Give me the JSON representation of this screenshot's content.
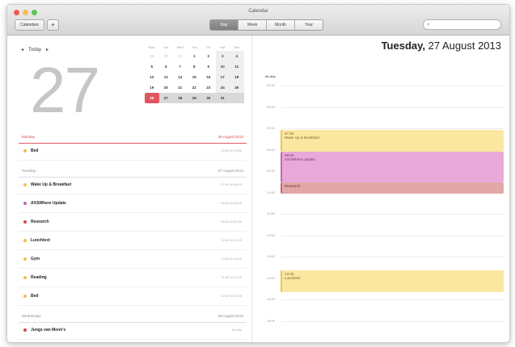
{
  "window": {
    "title": "Calendar",
    "calendars_label": "Calendars",
    "add_label": "+"
  },
  "view_tabs": [
    "Day",
    "Week",
    "Month",
    "Year"
  ],
  "active_tab": "Day",
  "left": {
    "nav": {
      "prev": "◂",
      "today": "Today",
      "next": "▸"
    },
    "big_day": "27",
    "mini_cal": {
      "weekdays": [
        "Mon",
        "Tue",
        "Wed",
        "Thu",
        "Fri",
        "Sat",
        "Sun"
      ],
      "rows": [
        [
          "29",
          "30",
          "31",
          "1",
          "2",
          "3",
          "4"
        ],
        [
          "5",
          "6",
          "7",
          "8",
          "9",
          "10",
          "11"
        ],
        [
          "12",
          "13",
          "14",
          "15",
          "16",
          "17",
          "18"
        ],
        [
          "19",
          "20",
          "21",
          "22",
          "23",
          "24",
          "25"
        ],
        [
          "26",
          "27",
          "28",
          "29",
          "30",
          "31",
          ""
        ]
      ],
      "selected": "26"
    },
    "sections": [
      {
        "label": "Monday",
        "date": "26 August 2013",
        "color": "red",
        "events": [
          {
            "title": "Bed",
            "time": "22:30 to 23:00",
            "dot": "#f4bd4f"
          }
        ]
      },
      {
        "label": "Tuesday",
        "date": "27 August 2013",
        "color": "grey",
        "events": [
          {
            "title": "Wake Up & Breakfast",
            "time": "07:00 to 08:00",
            "dot": "#f4bd4f"
          },
          {
            "title": "AXSWhere Update",
            "time": "08:00 to 09:00",
            "dot": "#c466ae"
          },
          {
            "title": "Research",
            "time": "09:00 to 09:30",
            "dot": "#d24951"
          },
          {
            "title": "Lunchtext",
            "time": "12:00 to 13:00",
            "dot": "#f4bd4f"
          },
          {
            "title": "Gym",
            "time": "13:30 to 15:00",
            "dot": "#f4bd4f"
          },
          {
            "title": "Reading",
            "time": "21:00 to 22:00",
            "dot": "#f4bd4f"
          },
          {
            "title": "Bed",
            "time": "22:30 to 23:00",
            "dot": "#f4bd4f"
          }
        ]
      },
      {
        "label": "Wednesday",
        "date": "28 August 2013",
        "color": "grey",
        "events": [
          {
            "title": "Jungs van Menn's",
            "time": "All-day",
            "dot": "#d24951"
          }
        ]
      }
    ]
  },
  "right": {
    "date_weekday": "Tuesday,",
    "date_rest": "27 August 2013",
    "allday_label": "all-day",
    "hours": [
      "05:00",
      "06:00",
      "07:00",
      "08:00",
      "09:00",
      "10:00",
      "11:00",
      "12:00",
      "13:00",
      "14:00",
      "15:00",
      "16:00"
    ],
    "events": [
      {
        "time": "07:00",
        "title": "Wake Up & Breakfast",
        "style": "yellow"
      },
      {
        "time": "08:00",
        "title": "AXSWhere Update",
        "style": "pink"
      },
      {
        "time": "",
        "title": "Research",
        "style": "rose"
      },
      {
        "time": "13:30",
        "title": "Lunchtext",
        "style": "yellow"
      }
    ]
  },
  "colors": {
    "accent_red": "#e0565e",
    "event_yellow": "#fbe7a0",
    "event_pink": "#e8a9d9",
    "event_rose": "#e2a8a8"
  }
}
